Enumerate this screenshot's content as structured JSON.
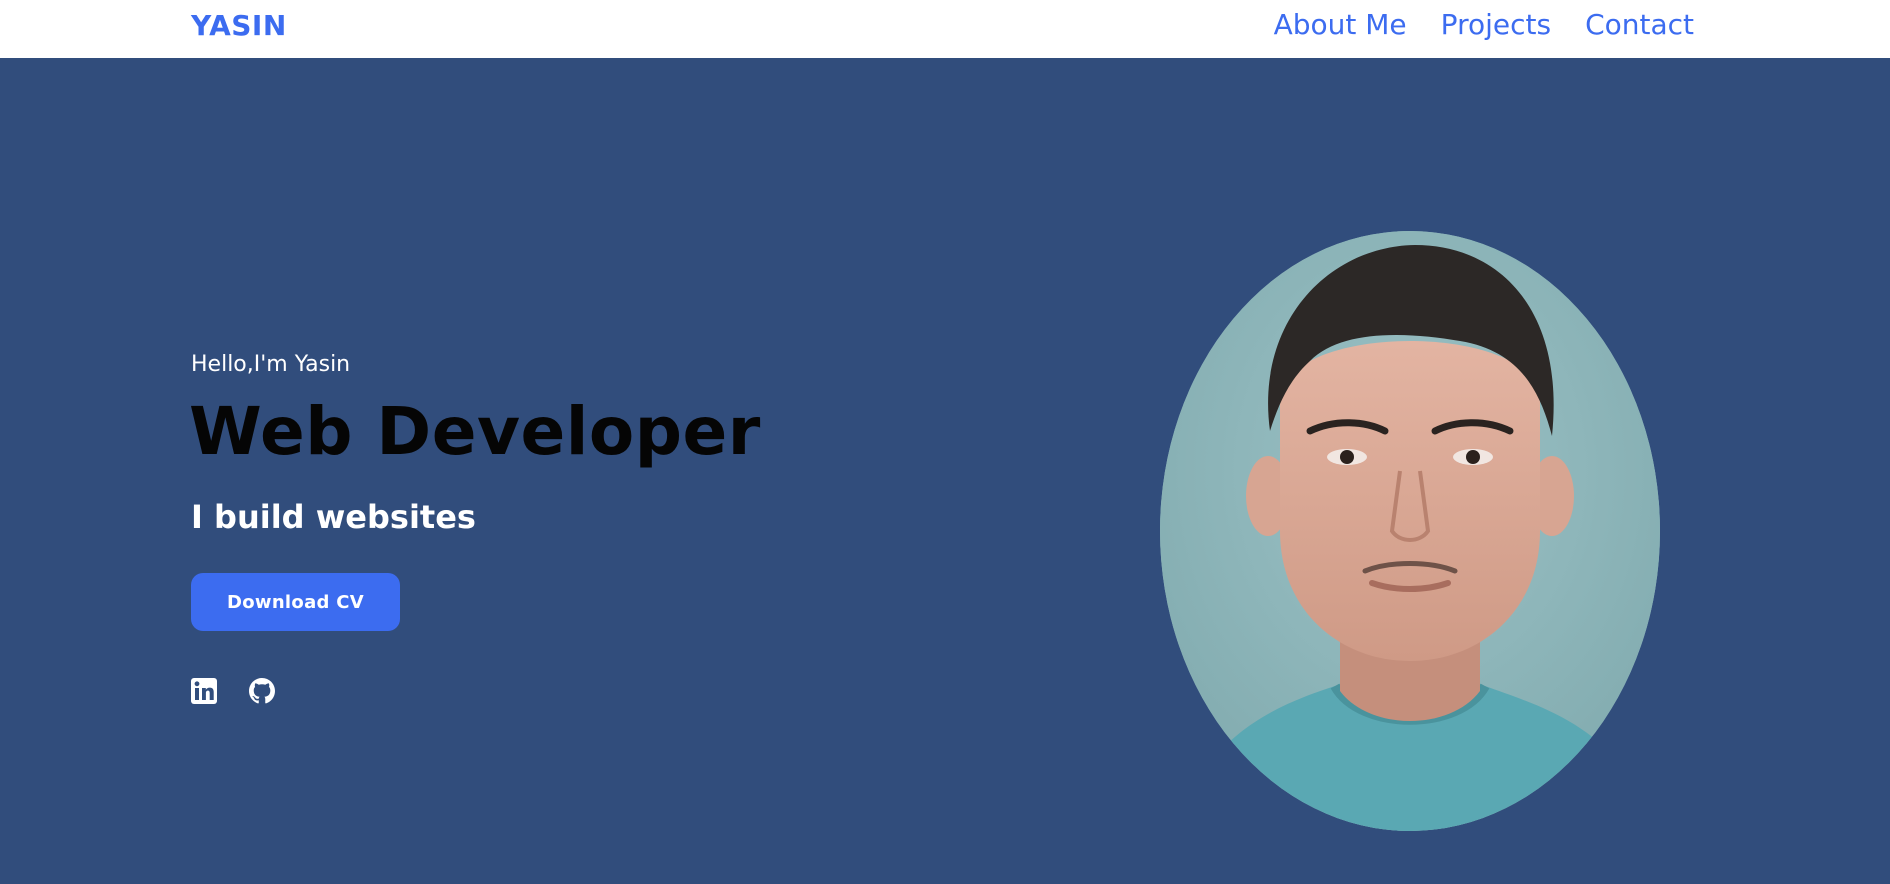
{
  "header": {
    "logo": "YASIN",
    "nav": [
      {
        "label": "About Me"
      },
      {
        "label": "Projects"
      },
      {
        "label": "Contact"
      }
    ]
  },
  "hero": {
    "greeting": "Hello,I'm Yasin",
    "title": "Web Developer",
    "subtitle": "I build websites",
    "cv_button": "Download CV",
    "socials": [
      {
        "icon": "linkedin-icon"
      },
      {
        "icon": "github-icon"
      }
    ]
  },
  "colors": {
    "accent": "#3c6cf0",
    "background": "#314d7c",
    "header_bg": "#ffffff"
  }
}
